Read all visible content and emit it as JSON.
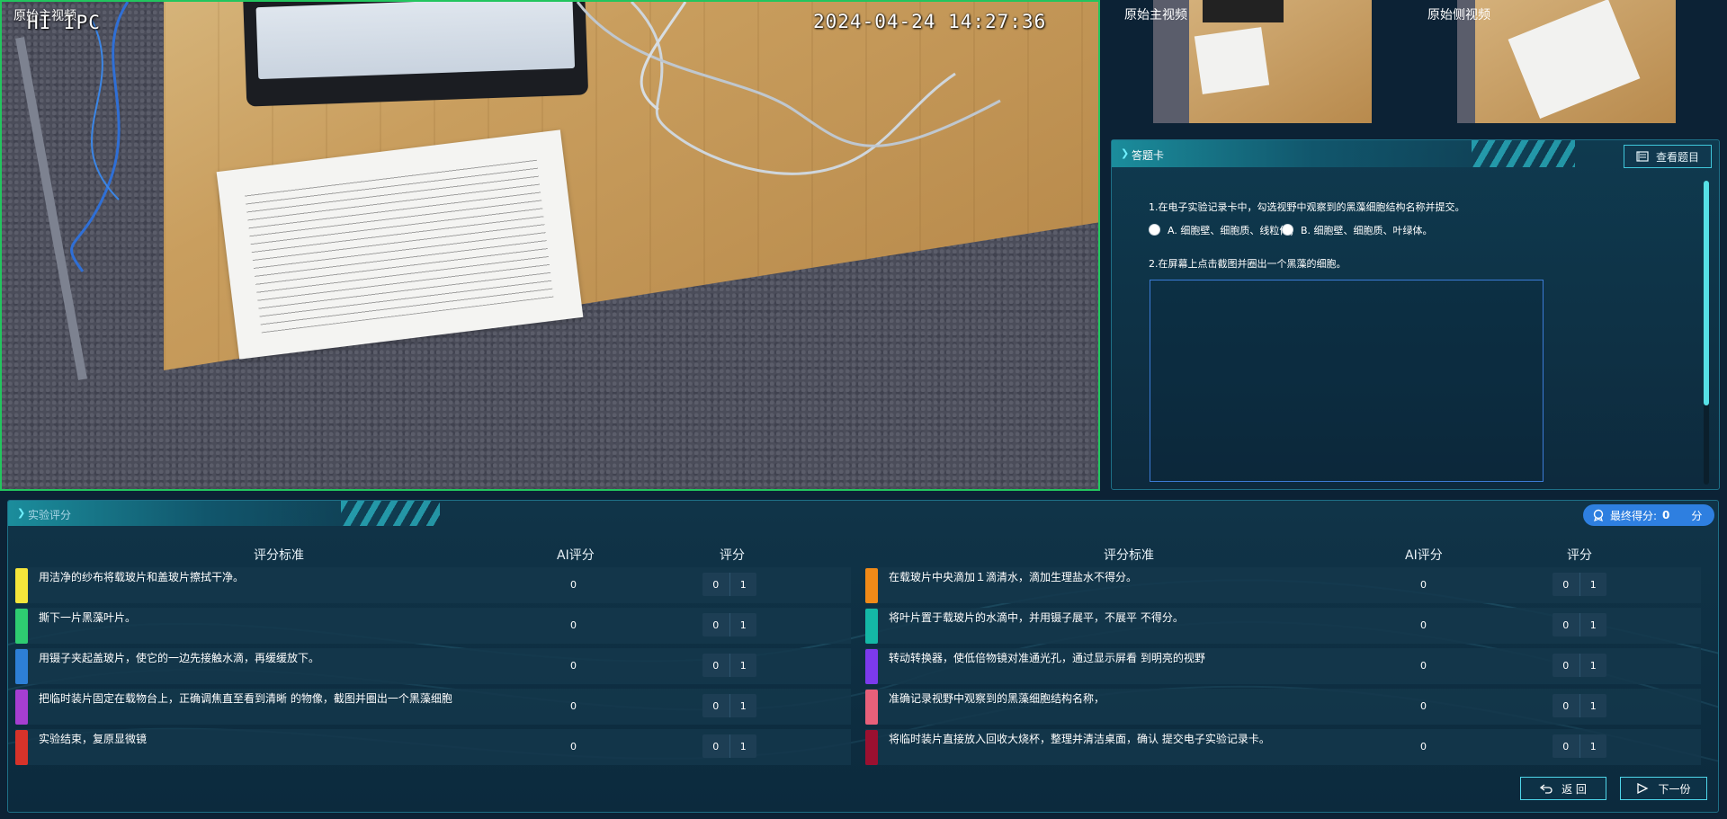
{
  "main_video": {
    "label": "原始主视频",
    "osd_name": "HI IPC",
    "osd_timestamp": "2024-04-24 14:27:36"
  },
  "thumbnails": {
    "main_label": "原始主视频",
    "side_label": "原始侧视频"
  },
  "answer_card": {
    "title": "答题卡",
    "view_questions_button": "查看题目",
    "q1_text": "1.在电子实验记录卡中，勾选视野中观察到的黑藻细胞结构名称并提交。",
    "q1_option_a": "A. 细胞壁、细胞质、线粒体；",
    "q1_option_b": "B. 细胞壁、细胞质、叶绿体。",
    "q2_text": "2.在屏幕上点击截图并圈出一个黑藻的细胞。"
  },
  "scoring": {
    "title": "实验评分",
    "final_label": "最终得分:",
    "final_value": "0",
    "final_unit": "分",
    "headers": {
      "criterion": "评分标准",
      "ai_score": "AI评分",
      "score": "评分"
    },
    "left_rows": [
      {
        "text": "用洁净的纱布将载玻片和盖玻片擦拭干净。",
        "ai": "0",
        "opt0": "0",
        "opt1": "1",
        "color": "#f5e53b"
      },
      {
        "text": "撕下一片黑藻叶片。",
        "ai": "0",
        "opt0": "0",
        "opt1": "1",
        "color": "#2ecc71"
      },
      {
        "text": "用镊子夹起盖玻片，使它的一边先接触水滴，再缓缓放下。",
        "ai": "0",
        "opt0": "0",
        "opt1": "1",
        "color": "#2d7fd6"
      },
      {
        "text": "把临时装片固定在载物台上，正确调焦直至看到清晰 的物像，截图并圈出一个黑藻细胞",
        "ai": "0",
        "opt0": "0",
        "opt1": "1",
        "color": "#a63ed1"
      },
      {
        "text": "实验结束，复原显微镜",
        "ai": "0",
        "opt0": "0",
        "opt1": "1",
        "color": "#d6332a"
      }
    ],
    "right_rows": [
      {
        "text": "在载玻片中央滴加１滴清水，滴加生理盐水不得分。",
        "ai": "0",
        "opt0": "0",
        "opt1": "1",
        "color": "#f08a18"
      },
      {
        "text": "将叶片置于载玻片的水滴中，并用镊子展平，不展平 不得分。",
        "ai": "0",
        "opt0": "0",
        "opt1": "1",
        "color": "#14b8a6"
      },
      {
        "text": "转动转换器，使低倍物镜对准通光孔，通过显示屏看 到明亮的视野",
        "ai": "0",
        "opt0": "0",
        "opt1": "1",
        "color": "#7c3aed"
      },
      {
        "text": "准确记录视野中观察到的黑藻细胞结构名称，",
        "ai": "0",
        "opt0": "0",
        "opt1": "1",
        "color": "#e8607a"
      },
      {
        "text": "将临时装片直接放入回收大烧杯，整理并清洁桌面，确认 提交电子实验记录卡。",
        "ai": "0",
        "opt0": "0",
        "opt1": "1",
        "color": "#9b1030"
      }
    ],
    "back_button": "返  回",
    "next_button": "下一份"
  }
}
